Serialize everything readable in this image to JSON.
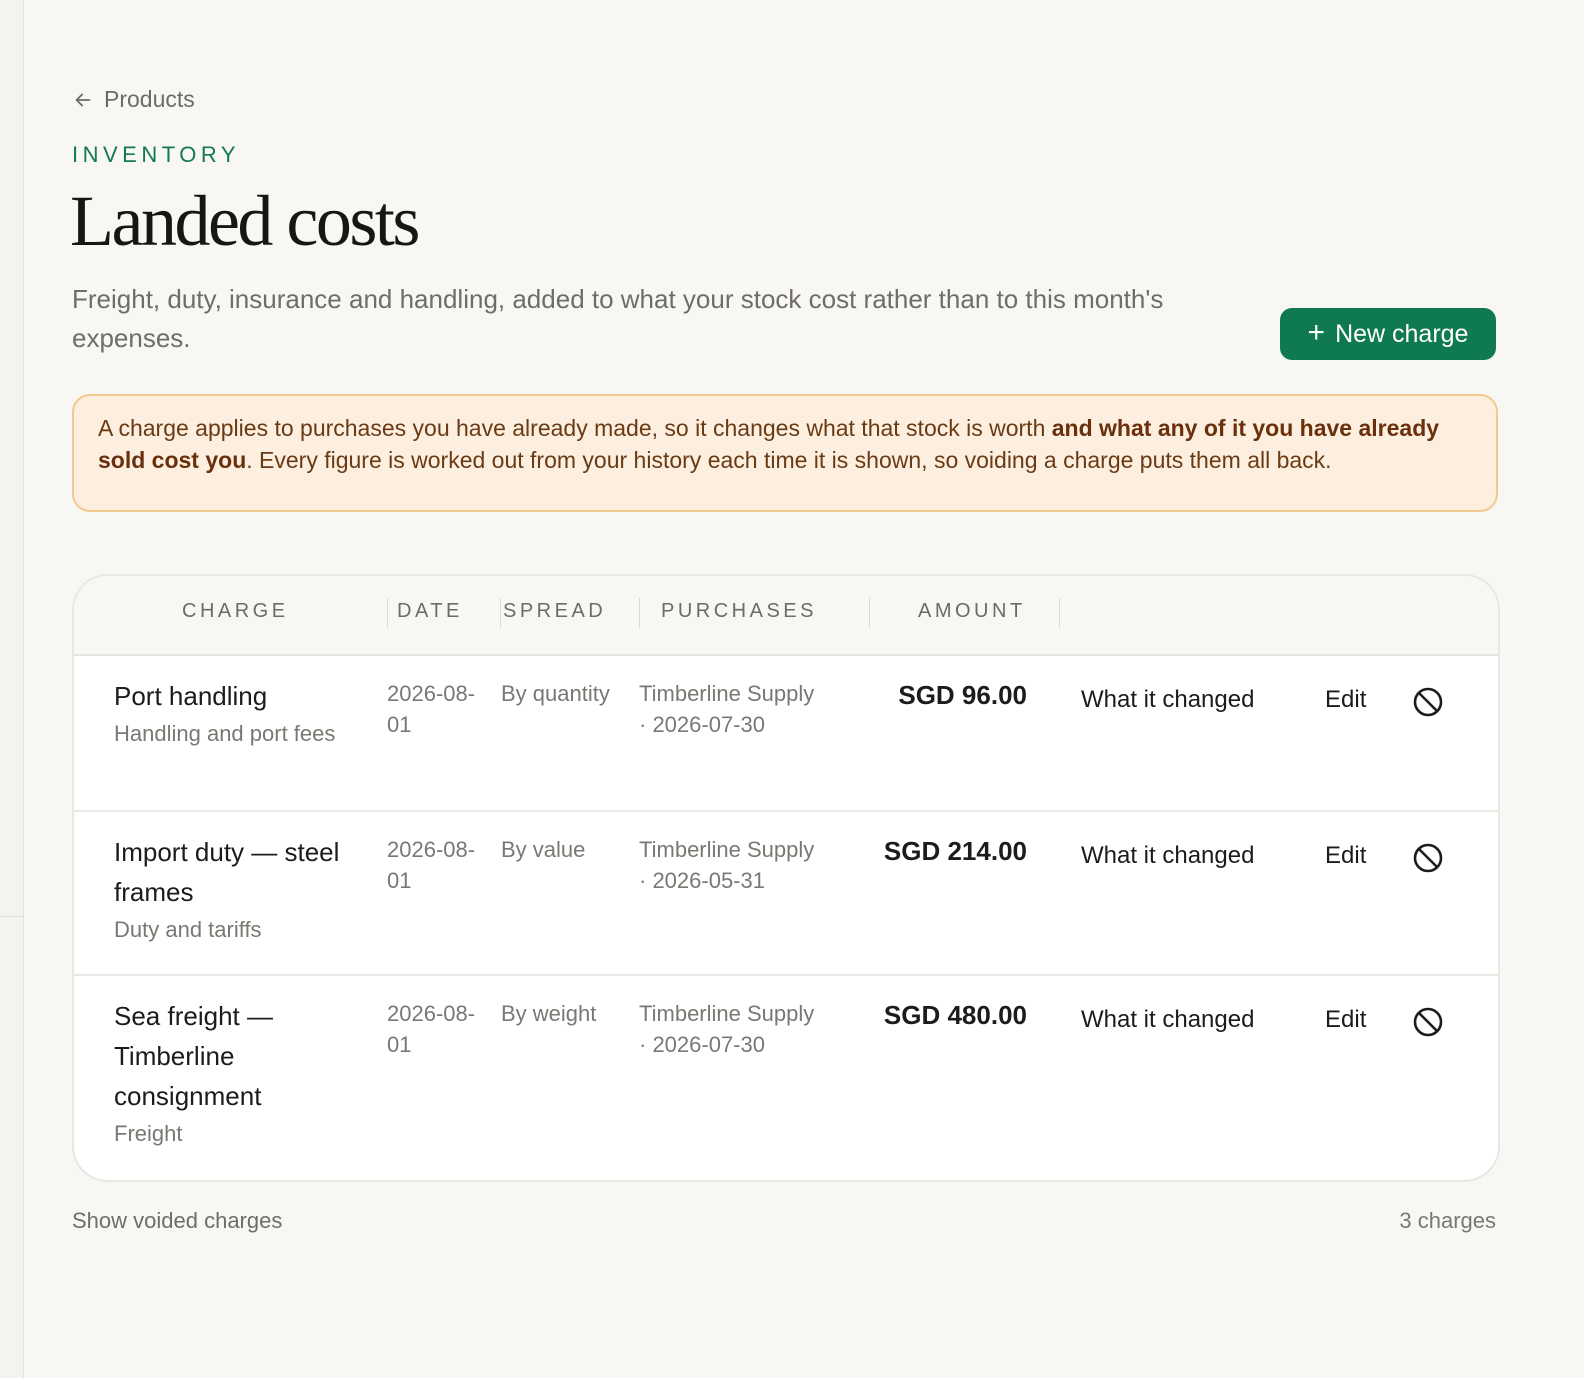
{
  "nav": {
    "back_label": "Products"
  },
  "header": {
    "eyebrow": "INVENTORY",
    "title": "Landed costs",
    "subtitle": "Freight, duty, insurance and handling, added to what your stock cost rather than to this month's expenses.",
    "new_charge_label": "New charge"
  },
  "notice": {
    "part1": "A charge applies to purchases you have already made, so it changes what that stock is worth ",
    "bold": "and what any of it you have already sold cost you",
    "part2": ". Every figure is worked out from your history each time it is shown, so voiding a charge puts them all back."
  },
  "table": {
    "columns": {
      "charge": "CHARGE",
      "date": "DATE",
      "spread": "SPREAD",
      "purchases": "PURCHASES",
      "amount": "AMOUNT"
    },
    "rows": [
      {
        "name": "Port handling",
        "category": "Handling and port fees",
        "date": "2026-08-01",
        "spread": "By quantity",
        "supplier": "Timberline Supply",
        "purchase_date": "· 2026-07-30",
        "amount": "SGD 96.00",
        "what_changed": "What it changed",
        "edit": "Edit"
      },
      {
        "name": "Import duty — steel frames",
        "category": "Duty and tariffs",
        "date": "2026-08-01",
        "spread": "By value",
        "supplier": "Timberline Supply",
        "purchase_date": "· 2026-05-31",
        "amount": "SGD 214.00",
        "what_changed": "What it changed",
        "edit": "Edit"
      },
      {
        "name": "Sea freight — Timberline consignment",
        "category": "Freight",
        "date": "2026-08-01",
        "spread": "By weight",
        "supplier": "Timberline Supply",
        "purchase_date": "· 2026-07-30",
        "amount": "SGD 480.00",
        "what_changed": "What it changed",
        "edit": "Edit"
      }
    ]
  },
  "footer": {
    "show_voided": "Show voided charges",
    "count": "3 charges"
  },
  "icons": {
    "back": "arrow-left-icon",
    "add": "plus-icon",
    "void": "void-circle-slash-icon"
  },
  "colors": {
    "accent": "#0f7a4f",
    "notice_bg": "#fcefe0",
    "notice_border": "#f1c98f",
    "notice_text": "#6a3a13"
  }
}
